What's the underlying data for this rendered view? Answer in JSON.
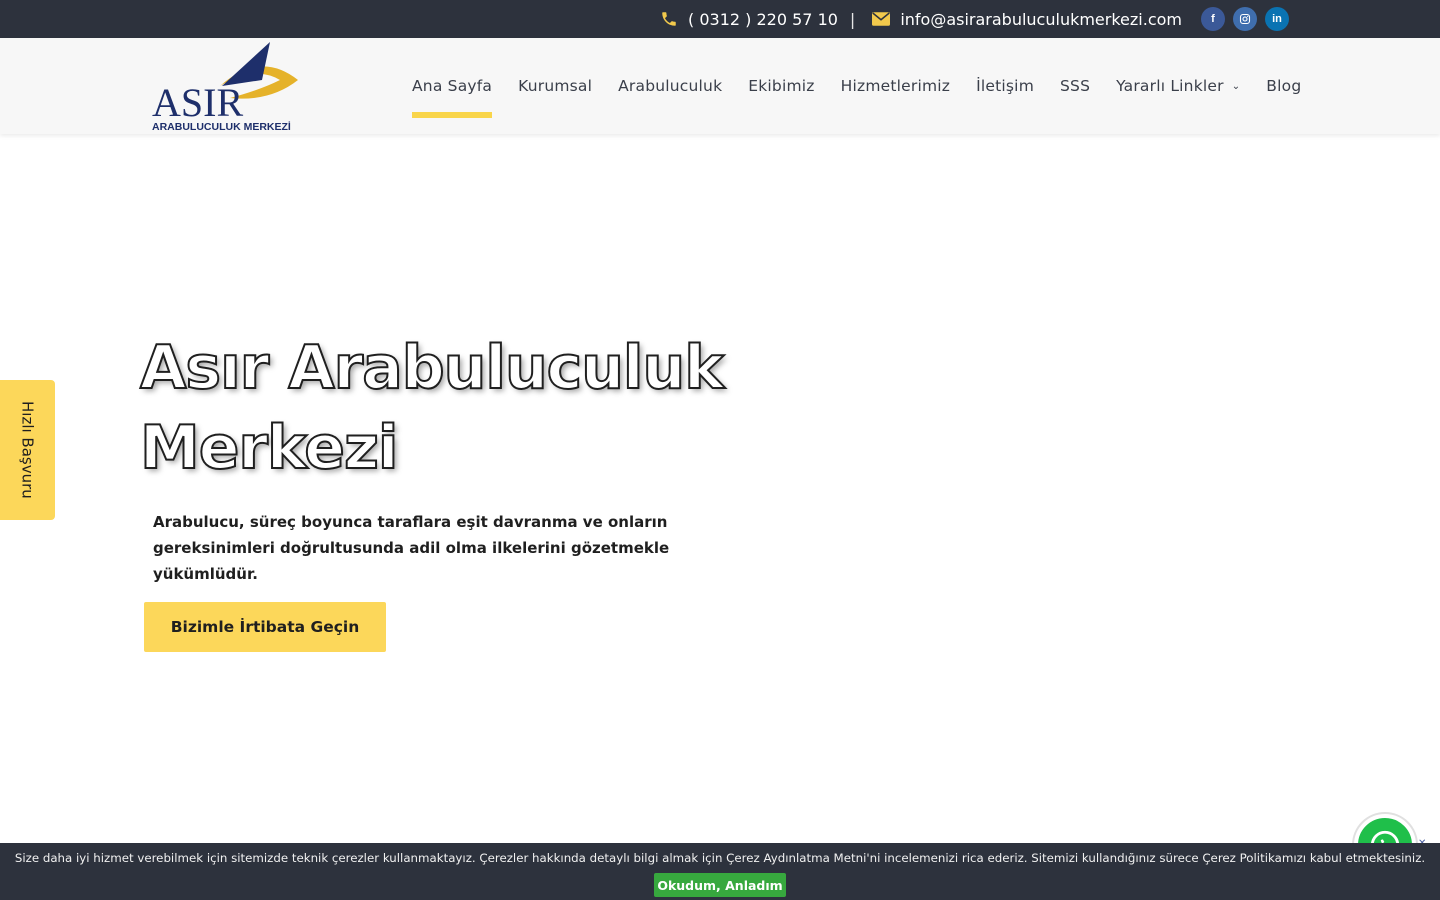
{
  "topbar": {
    "phone": "( 0312 ) 220 57 10",
    "separator": "|",
    "email": "info@asirarabuluculukmerkezi.com",
    "social": [
      "facebook-icon",
      "instagram-icon",
      "linkedin-icon"
    ]
  },
  "logo": {
    "brand": "ASIR",
    "sub": "ARABULUCULUK MERKEZİ"
  },
  "nav": {
    "items": [
      {
        "label": "Ana Sayfa",
        "active": true
      },
      {
        "label": "Kurumsal"
      },
      {
        "label": "Arabuluculuk"
      },
      {
        "label": "Ekibimiz"
      },
      {
        "label": "Hizmetlerimiz"
      },
      {
        "label": "İletişim"
      },
      {
        "label": "SSS"
      },
      {
        "label": "Yararlı Linkler",
        "dropdown": true
      },
      {
        "label": "Blog"
      }
    ]
  },
  "hero": {
    "title_line1": "Asır Arabuluculuk",
    "title_line2": "Merkezi",
    "subtitle": "Arabulucu, süreç boyunca taraflara eşit davranma ve onların gereksinimleri doğrultusunda adil olma ilkelerini gözetmekle yükümlüdür.",
    "cta": "Bizimle İrtibata Geçin"
  },
  "side_tab": {
    "label": "Hızlı Başvuru"
  },
  "cookie": {
    "text": "Size daha iyi hizmet verebilmek için sitemizde teknik çerezler kullanmaktayız. Çerezler hakkında detaylı bilgi almak için Çerez Aydınlatma Metni'ni incelemenizi rica ederiz. Sitemizi kullandığınız sürece Çerez Politikamızı kabul etmektesiniz.",
    "button": "Okudum, Anladım"
  },
  "colors": {
    "topbar": "#2d323d",
    "accent": "#fcd75a",
    "cookie_button": "#37a83e",
    "whatsapp": "#1fbf4a"
  }
}
